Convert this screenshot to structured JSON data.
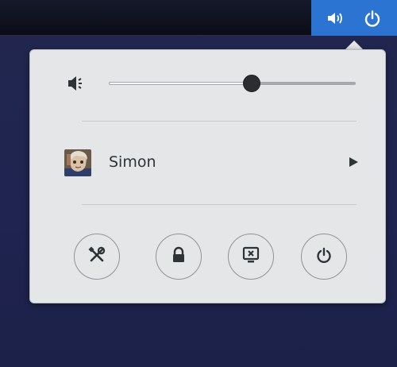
{
  "top_bar": {
    "status_icons": [
      "volume-icon",
      "power-icon"
    ],
    "accent_color": "#2b74d1"
  },
  "system_menu": {
    "volume": {
      "icon": "speaker-icon",
      "level": 0.58
    },
    "user": {
      "name": "Simon",
      "avatar": "user-avatar",
      "has_submenu": true
    },
    "actions": [
      {
        "icon": "settings-icon"
      },
      {
        "icon": "lock-icon"
      },
      {
        "icon": "switch-user-icon"
      },
      {
        "icon": "power-off-icon"
      }
    ]
  }
}
